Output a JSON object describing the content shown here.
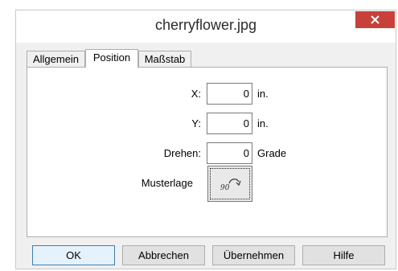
{
  "window": {
    "title": "cherryflower.jpg"
  },
  "tabs": [
    {
      "label": "Allgemein",
      "active": false
    },
    {
      "label": "Position",
      "active": true
    },
    {
      "label": "Maßstab",
      "active": false
    }
  ],
  "fields": {
    "x": {
      "label": "X:",
      "value": "0",
      "unit": "in."
    },
    "y": {
      "label": "Y:",
      "value": "0",
      "unit": "in."
    },
    "rotate": {
      "label": "Drehen:",
      "value": "0",
      "unit": "Grade"
    }
  },
  "sample": {
    "label": "Musterlage",
    "button_text": "90"
  },
  "buttons": {
    "ok": "OK",
    "cancel": "Abbrechen",
    "apply": "Übernehmen",
    "help": "Hilfe"
  },
  "colors": {
    "close_button": "#c7403a",
    "default_button_border": "#3c7fb1"
  },
  "icons": {
    "close": "close-icon",
    "rotate": "rotate-90-icon"
  }
}
